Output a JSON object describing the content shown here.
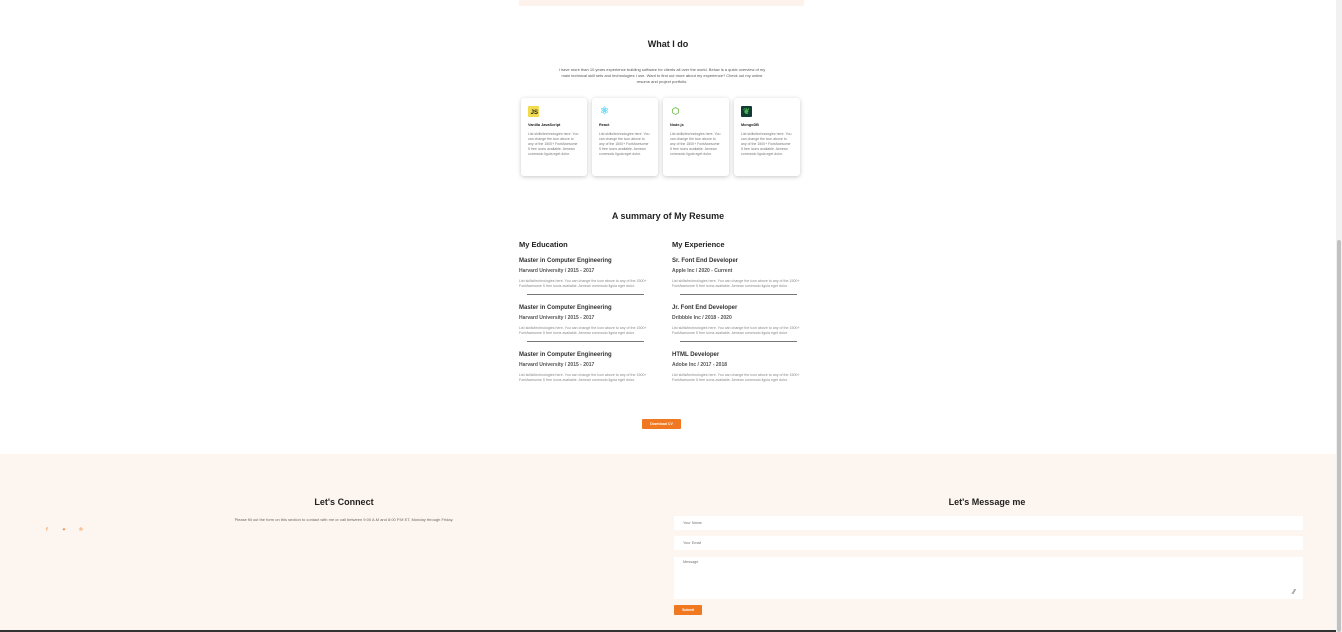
{
  "what_i_do": {
    "title": "What I do",
    "intro": "I have more than 10 years experience building software for clients all over the world. Below is a quick overview of my main technical skill sets and technologies I use. Want to find out more about my experience? Check out my online resume and project portfolio.",
    "cards": [
      {
        "icon": "js-icon",
        "icon_text": "JS",
        "title": "Vanilla JavaScript",
        "desc": "List skills/technologies here. You can change the icon above to any of the 1500+ FontAwesome 5 free icons available. Aenean commodo ligula eget dolor."
      },
      {
        "icon": "react-icon",
        "icon_text": "⚛",
        "title": "React",
        "desc": "List skills/technologies here. You can change the icon above to any of the 1500+ FontAwesome 5 free icons available. Aenean commodo ligula eget dolor."
      },
      {
        "icon": "nodejs-icon",
        "icon_text": "⬡",
        "title": "Node.js",
        "desc": "List skills/technologies here. You can change the icon above to any of the 1500+ FontAwesome 5 free icons available. Aenean commodo ligula eget dolor."
      },
      {
        "icon": "mongodb-icon",
        "icon_text": "❦",
        "title": "MongoDB",
        "desc": "List skills/technologies here. You can change the icon above to any of the 1500+ FontAwesome 5 free icons available. Aenean commodo ligula eget dolor."
      }
    ]
  },
  "resume": {
    "title": "A summary of My Resume",
    "education": {
      "heading": "My Education",
      "entries": [
        {
          "title": "Master in Computer Engineering",
          "sub": "Harvard University / 2015 - 2017",
          "desc": "List skills/technologies here. You can change the icon above to any of the 1500+ FontAwesome 5 free icons available. Aenean commodo ligula eget dolor."
        },
        {
          "title": "Master in Computer Engineering",
          "sub": "Harvard University / 2015 - 2017",
          "desc": "List skills/technologies here. You can change the icon above to any of the 1500+ FontAwesome 5 free icons available. Aenean commodo ligula eget dolor."
        },
        {
          "title": "Master in Computer Engineering",
          "sub": "Harvard University / 2015 - 2017",
          "desc": "List skills/technologies here. You can change the icon above to any of the 1500+ FontAwesome 5 free icons available. Aenean commodo ligula eget dolor."
        }
      ]
    },
    "experience": {
      "heading": "My Experience",
      "entries": [
        {
          "title": "Sr. Font End Developer",
          "sub": "Apple Inc / 2020 - Current",
          "desc": "List skills/technologies here. You can change the icon above to any of the 1500+ FontAwesome 5 free icons available. Aenean commodo ligula eget dolor."
        },
        {
          "title": "Jr. Font End Developer",
          "sub": "Dribbble Inc / 2018 - 2020",
          "desc": "List skills/technologies here. You can change the icon above to any of the 1500+ FontAwesome 5 free icons available. Aenean commodo ligula eget dolor."
        },
        {
          "title": "HTML Developer",
          "sub": "Adobe Inc / 2017 - 2018",
          "desc": "List skills/technologies here. You can change the icon above to any of the 1500+ FontAwesome 5 free icons available. Aenean commodo ligula eget dolor."
        }
      ]
    },
    "download_label": "Download CV"
  },
  "footer": {
    "connect_title": "Let's Connect",
    "connect_text": "Please fill out the form on this section to contact with me or call between 9:00 A.M and 8:00 P.M ET, Monday through Friday.",
    "socials": [
      {
        "icon": "facebook-icon",
        "glyph": "f"
      },
      {
        "icon": "twitter-icon",
        "glyph": "✦"
      },
      {
        "icon": "pinterest-icon",
        "glyph": "℗"
      }
    ],
    "message_title": "Let's Message me",
    "name_placeholder": "Your Name",
    "email_placeholder": "Your Email",
    "message_placeholder": "Message",
    "submit_label": "Submit"
  },
  "colors": {
    "accent": "#f07821",
    "footer_bg": "#fdf6f0"
  }
}
